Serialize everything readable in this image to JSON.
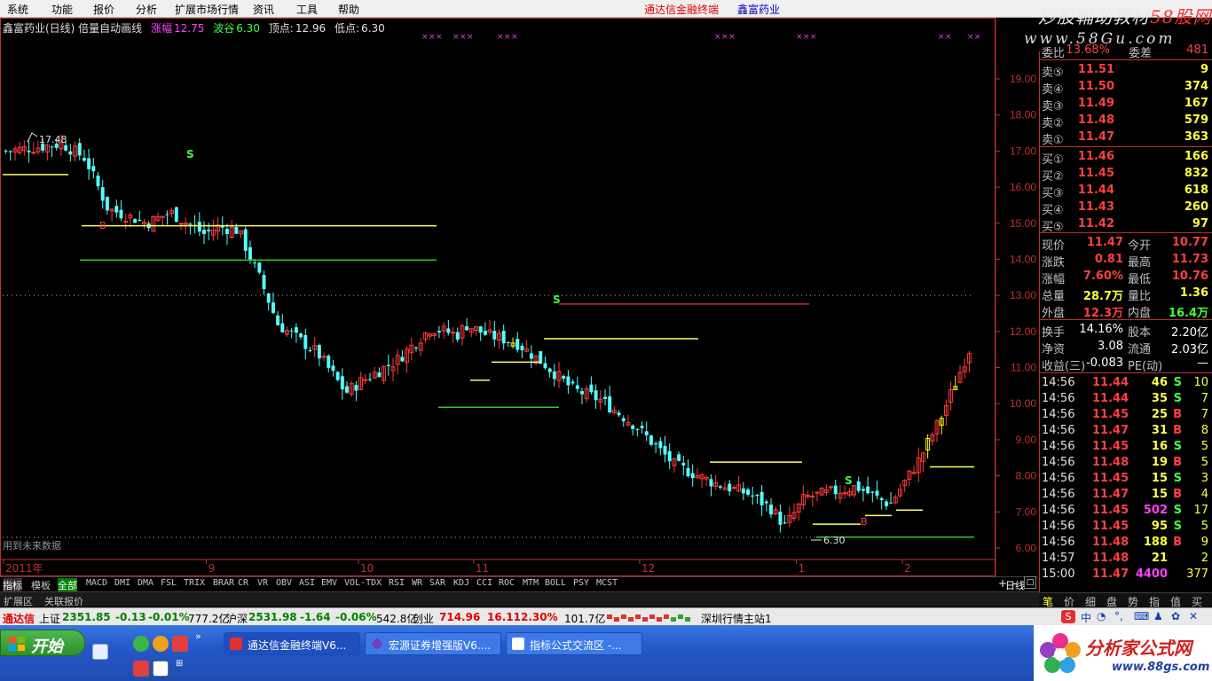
{
  "menubar": {
    "items": [
      "系统",
      "功能",
      "报价",
      "分析",
      "扩展市场行情",
      "资讯",
      "工具",
      "帮助"
    ],
    "app_title": "通达信金融终端",
    "stock_title": "鑫富药业"
  },
  "brand_logo": {
    "line1_a": "炒股輔助教材",
    "line1_b": "58股网",
    "line2": "www.58Gu.com"
  },
  "chart_info": {
    "stock_name": "鑫富药业(日线) 倍量自动画线",
    "label_rise": "涨幅",
    "value_rise": "12.75",
    "label_trough": "波谷",
    "value_trough": "6.30",
    "label_peak": "顶点:",
    "value_peak": "12.96",
    "label_low": "低点:",
    "value_low": "6.30"
  },
  "chart_labels": {
    "high_marker": "17.48",
    "low_marker": "6.30",
    "future_data": "用到未来数据",
    "s_marks": [
      "S",
      "S",
      "S"
    ],
    "b_marks": [
      "B",
      "B"
    ]
  },
  "chart_data": {
    "type": "candlestick",
    "ylim": [
      6.0,
      19.5
    ],
    "y_ticks": [
      "19.00",
      "18.00",
      "17.00",
      "16.00",
      "15.00",
      "14.00",
      "13.00",
      "12.00",
      "11.00",
      "10.00",
      "9.00",
      "8.00",
      "7.00",
      "6.00"
    ],
    "x_ticks": [
      "2011年",
      "9",
      "10",
      "11",
      "12",
      "1",
      "2"
    ],
    "x_tick_index": [
      0,
      44,
      77,
      102,
      138,
      172,
      195
    ],
    "n_candles": 210,
    "candle_colors": {
      "up": "#ff3a3a",
      "down": "#54ffff",
      "highlight": "#ffff00"
    }
  },
  "indicator_tabs": {
    "active": "指标",
    "template": "模板",
    "all": "全部",
    "items": [
      "MACD",
      "DMI",
      "DMA",
      "FSL",
      "TRIX",
      "BRAR",
      "CR",
      "VR",
      "OBV",
      "ASI",
      "EMV",
      "VOL-TDX",
      "RSI",
      "WR",
      "SAR",
      "KDJ",
      "CCI",
      "ROC",
      "MTM",
      "BOLL",
      "PSY",
      "MCST"
    ],
    "corner_label": "日线",
    "plus": "+",
    "minus": "-"
  },
  "ext_bar": {
    "area": "扩展区",
    "linked": "关联报价"
  },
  "quote_panel": {
    "cut_row": {
      "l1": "委比",
      "v1": "13.68%",
      "l2": "委差",
      "v2": "481"
    },
    "sell": [
      {
        "label": "卖⑤",
        "price": "11.51",
        "vol": "9"
      },
      {
        "label": "卖④",
        "price": "11.50",
        "vol": "374"
      },
      {
        "label": "卖③",
        "price": "11.49",
        "vol": "167"
      },
      {
        "label": "卖②",
        "price": "11.48",
        "vol": "579"
      },
      {
        "label": "卖①",
        "price": "11.47",
        "vol": "363"
      }
    ],
    "buy": [
      {
        "label": "买①",
        "price": "11.46",
        "vol": "166"
      },
      {
        "label": "买②",
        "price": "11.45",
        "vol": "832"
      },
      {
        "label": "买③",
        "price": "11.44",
        "vol": "618"
      },
      {
        "label": "买④",
        "price": "11.43",
        "vol": "260"
      },
      {
        "label": "买⑤",
        "price": "11.42",
        "vol": "97"
      }
    ],
    "stats": [
      {
        "l1": "现价",
        "v1": "11.47",
        "l2": "今开",
        "v2": "10.77"
      },
      {
        "l1": "涨跌",
        "v1": "0.81",
        "l2": "最高",
        "v2": "11.73"
      },
      {
        "l1": "涨幅",
        "v1": "7.60%",
        "l2": "最低",
        "v2": "10.76"
      },
      {
        "l1": "总量",
        "v1": "28.7万",
        "l2": "量比",
        "v2": "1.36"
      },
      {
        "l1": "外盘",
        "v1": "12.3万",
        "l2": "内盘",
        "v2": "16.4万"
      }
    ],
    "fund": [
      {
        "l1": "换手",
        "v1": "14.16%",
        "l2": "股本",
        "v2": "2.20亿"
      },
      {
        "l1": "净资",
        "v1": "3.08",
        "l2": "流通",
        "v2": "2.03亿"
      },
      {
        "l1": "收益(三)",
        "v1": "-0.083",
        "l2": "PE(动)",
        "v2": "—"
      }
    ],
    "ticks": [
      {
        "time": "14:56",
        "price": "11.44",
        "vol": "46",
        "side": "S",
        "n": "10"
      },
      {
        "time": "14:56",
        "price": "11.44",
        "vol": "35",
        "side": "S",
        "n": "7"
      },
      {
        "time": "14:56",
        "price": "11.45",
        "vol": "25",
        "side": "B",
        "n": "7"
      },
      {
        "time": "14:56",
        "price": "11.47",
        "vol": "31",
        "side": "B",
        "n": "8"
      },
      {
        "time": "14:56",
        "price": "11.45",
        "vol": "16",
        "side": "S",
        "n": "5"
      },
      {
        "time": "14:56",
        "price": "11.48",
        "vol": "19",
        "side": "B",
        "n": "5"
      },
      {
        "time": "14:56",
        "price": "11.45",
        "vol": "15",
        "side": "S",
        "n": "3"
      },
      {
        "time": "14:56",
        "price": "11.47",
        "vol": "15",
        "side": "B",
        "n": "4"
      },
      {
        "time": "14:56",
        "price": "11.45",
        "vol": "502",
        "side": "S",
        "n": "17"
      },
      {
        "time": "14:56",
        "price": "11.45",
        "vol": "95",
        "side": "S",
        "n": "5"
      },
      {
        "time": "14:56",
        "price": "11.48",
        "vol": "188",
        "side": "B",
        "n": "9"
      },
      {
        "time": "14:57",
        "price": "11.48",
        "vol": "21",
        "side": "",
        "n": "2"
      },
      {
        "time": "15:00",
        "price": "11.47",
        "vol": "4400",
        "side": "",
        "n": "377"
      }
    ]
  },
  "panel_tabs": [
    "笔",
    "价",
    "细",
    "盘",
    "势",
    "指",
    "值",
    "买"
  ],
  "status_bar": {
    "app": "通达信",
    "sh_label": "上证",
    "sh_value": "2351.85",
    "sh_chg": "-0.13",
    "sh_pct": "-0.01%",
    "sh_amt": "777.2亿",
    "sz_label": "沪深",
    "sz_value": "2531.98",
    "sz_chg": "-1.64",
    "sz_pct": "-0.06%",
    "sz_amt": "542.8亿",
    "cy_label": "创业",
    "cy_value": "714.96",
    "cy_chg": "16.11",
    "cy_pct": "2.30%",
    "cy_amt": "101.7亿",
    "server": "深圳行情主站1"
  },
  "taskbar": {
    "start": "开始",
    "tasks": [
      "通达信金融终端V6...",
      "宏源证券增强版V6....",
      "指标公式交流区 -..."
    ]
  },
  "watermark": {
    "site": "分析家公式网",
    "url": "www.88gs.com"
  }
}
